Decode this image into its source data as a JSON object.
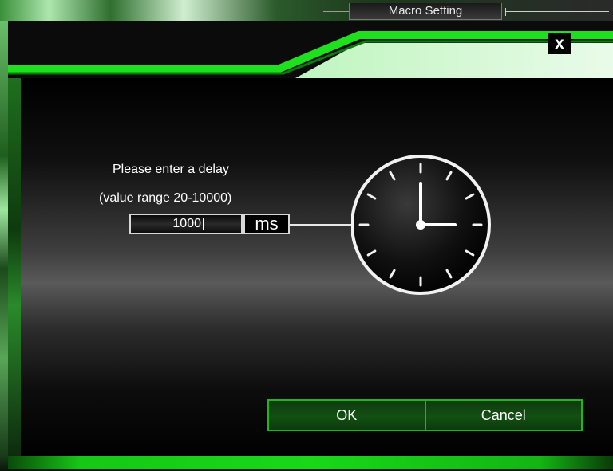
{
  "window": {
    "title": "Macro Setting"
  },
  "dialog": {
    "close_label": "x",
    "prompt_line1": "Please enter a delay",
    "prompt_line2": "(value range 20-10000)",
    "delay_value": "1000",
    "unit_label": "ms",
    "ok_label": "OK",
    "cancel_label": "Cancel",
    "accent_color": "#19d419",
    "clock_hour": 3,
    "clock_minute": 0
  }
}
